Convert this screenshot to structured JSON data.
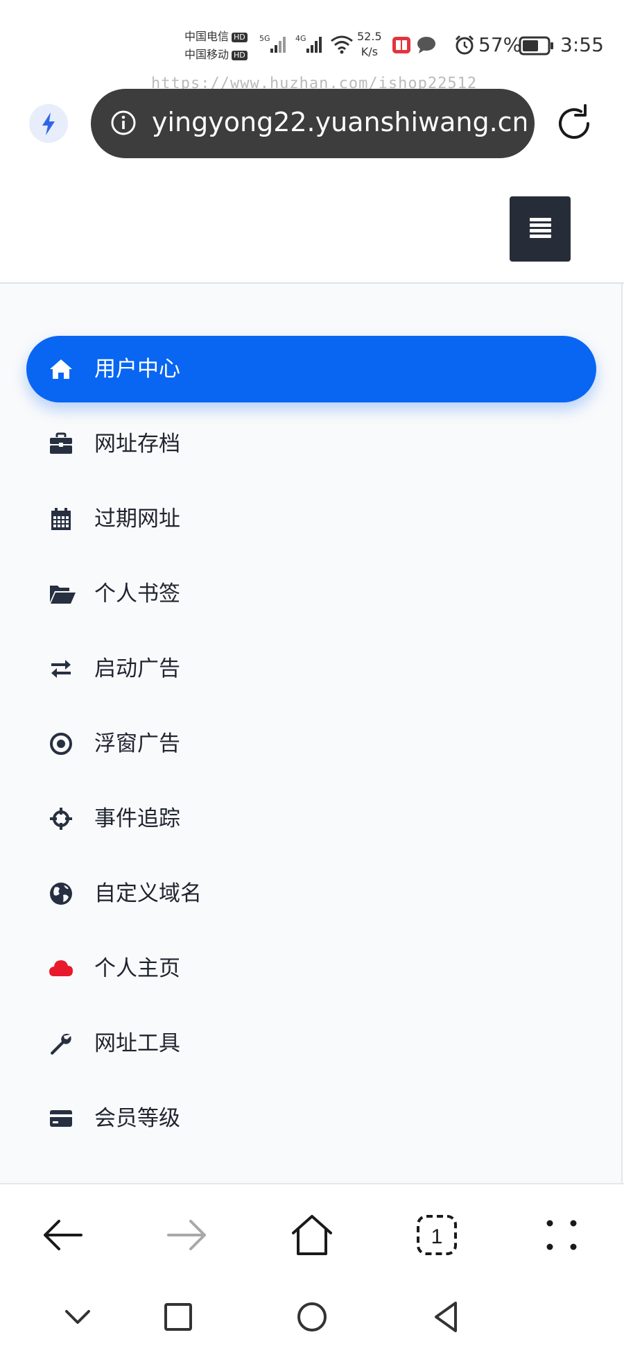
{
  "status_bar": {
    "carrier_1": "中国电信",
    "carrier_2": "中国移动",
    "hd_label": "HD",
    "net_5g": "5G",
    "net_4g": "4G",
    "speed_value": "52.5",
    "speed_unit": "K/s",
    "battery": "57%",
    "time": "3:55"
  },
  "watermark": "https://www.huzhan.com/ishop22512",
  "browser": {
    "url": "yingyong22.yuanshiwang.cn/"
  },
  "sidebar": {
    "accent_color": "#0866f3",
    "items": [
      {
        "label": "用户中心",
        "icon": "home-icon",
        "active": true
      },
      {
        "label": "网址存档",
        "icon": "briefcase-icon"
      },
      {
        "label": "过期网址",
        "icon": "calendar-icon"
      },
      {
        "label": "个人书签",
        "icon": "folder-open-icon"
      },
      {
        "label": "启动广告",
        "icon": "exchange-arrows-icon"
      },
      {
        "label": "浮窗广告",
        "icon": "target-icon"
      },
      {
        "label": "事件追踪",
        "icon": "crosshairs-icon"
      },
      {
        "label": "自定义域名",
        "icon": "globe-icon"
      },
      {
        "label": "个人主页",
        "icon": "cloud-icon",
        "icon_color": "#e8192c"
      },
      {
        "label": "网址工具",
        "icon": "wrench-icon"
      },
      {
        "label": "会员等级",
        "icon": "credit-card-icon"
      }
    ]
  },
  "browser_nav": [
    "back-arrow-icon",
    "forward-arrow-icon",
    "home-outline-icon",
    "tab-count-icon",
    "more-dots-icon"
  ],
  "tab_count": "1"
}
